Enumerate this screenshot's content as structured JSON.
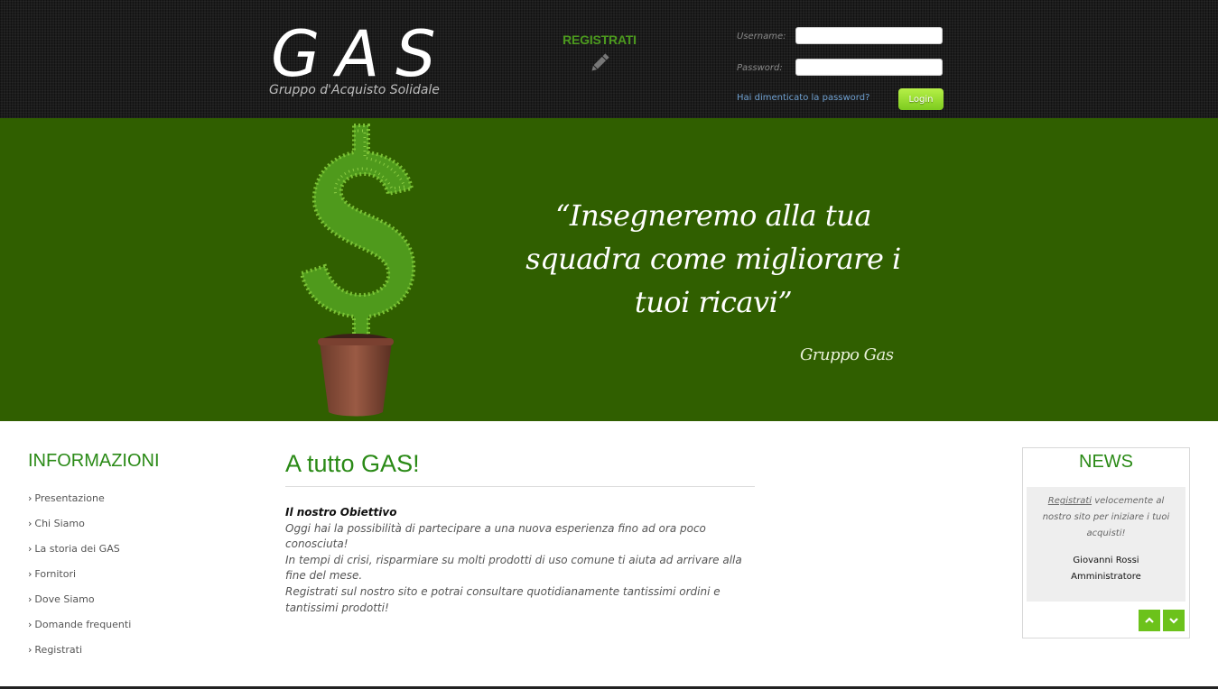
{
  "header": {
    "logo_title": "GAS",
    "logo_subtitle": "Gruppo d'Acquisto Solidale",
    "register_label": "REGISTRATI",
    "login": {
      "username_label": "Username:",
      "password_label": "Password:",
      "username_value": "",
      "password_value": "",
      "forgot_password": "Hai dimenticato la password?",
      "login_button": "Login"
    }
  },
  "banner": {
    "quote": "“Insegneremo alla tua squadra come migliorare i tuoi ricavi”",
    "author": "Gruppo Gas"
  },
  "sidebar": {
    "title": "INFORMAZIONI",
    "items": [
      {
        "label": "Presentazione"
      },
      {
        "label": "Chi Siamo"
      },
      {
        "label": "La storia dei GAS"
      },
      {
        "label": "Fornitori"
      },
      {
        "label": "Dove Siamo"
      },
      {
        "label": "Domande frequenti"
      },
      {
        "label": "Registrati"
      }
    ]
  },
  "main": {
    "title": "A tutto GAS!",
    "article_heading": "Il nostro Obiettivo",
    "paragraphs": [
      "Oggi hai la possibilità di partecipare a una nuova esperienza fino ad ora poco conosciuta!",
      "In tempi di crisi, risparmiare su molti prodotti di uso comune ti aiuta ad arrivare alla fine del mese.",
      "Registrati sul nostro sito e potrai consultare quotidianamente tantissimi ordini e tantissimi prodotti!"
    ]
  },
  "news": {
    "title": "NEWS",
    "item": {
      "link_text": "Registrati",
      "text": " velocemente al nostro sito per iniziare i tuoi acquisti!",
      "author_name": "Giovanni Rossi",
      "author_role": "Amministratore"
    }
  },
  "colors": {
    "brand_green": "#2a8a16",
    "banner_green": "#305f00",
    "button_green": "#6cc21b",
    "header_dark": "#1c1c1c"
  },
  "icons": {
    "register": "pencil-icon",
    "news_prev": "chevron-up-icon",
    "news_next": "chevron-down-icon",
    "menu_bullet": "chevron-right-icon"
  }
}
